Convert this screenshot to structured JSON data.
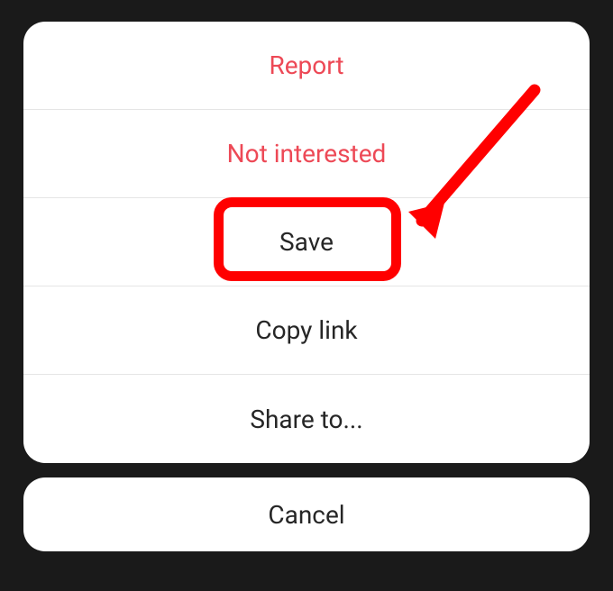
{
  "actionSheet": {
    "report": "Report",
    "notInterested": "Not interested",
    "save": "Save",
    "copyLink": "Copy link",
    "shareTo": "Share to..."
  },
  "cancel": "Cancel",
  "colors": {
    "destructive": "#ed4956",
    "normal": "#262626",
    "highlight": "#ff0000"
  }
}
